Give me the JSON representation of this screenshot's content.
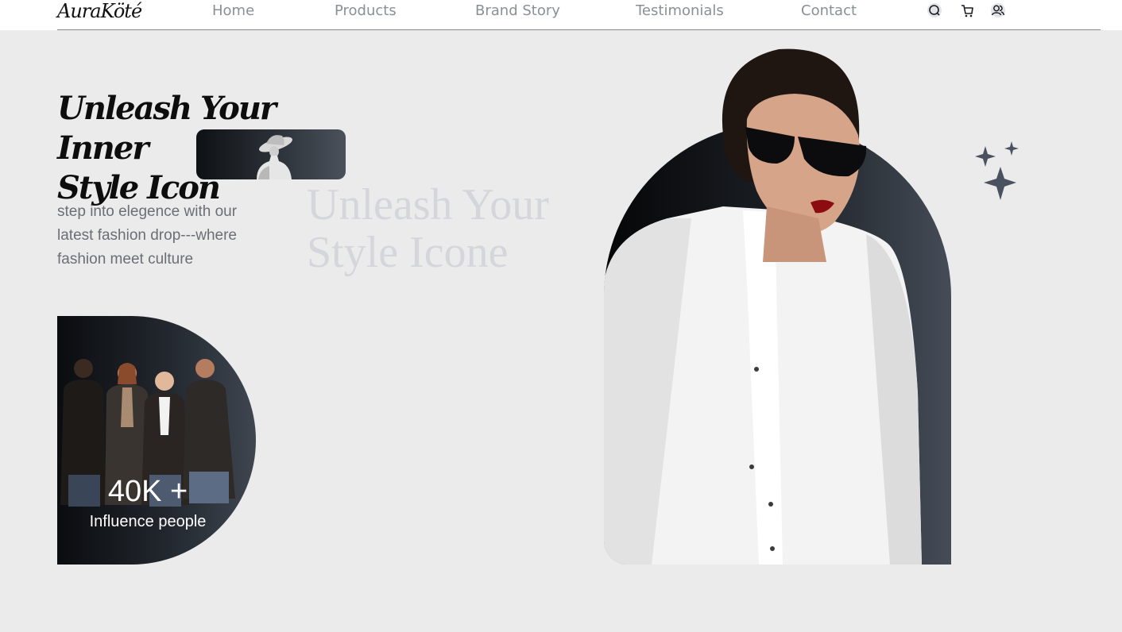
{
  "brand": {
    "logo_text": "AuraKöté"
  },
  "nav": {
    "links": [
      "Home",
      "Products",
      "Brand Story",
      "Testimonials",
      "Contact"
    ],
    "icons": [
      "search-icon",
      "cart-icon",
      "user-icon"
    ]
  },
  "hero": {
    "title_line1": "Unleash Your Inner",
    "title_line2": "Style Icon",
    "description": "step into elegence with our latest fashion drop---where fashion meet culture",
    "ghost_title_line1": "Unleash Your",
    "ghost_title_line2": "Style Icone"
  },
  "stats": {
    "value": "40K +",
    "label": "Influence people"
  },
  "colors": {
    "background": "#ebebeb",
    "nav_text": "#8b8f96",
    "dark_accent": "#1d2127",
    "slate_accent": "#4a5568"
  }
}
